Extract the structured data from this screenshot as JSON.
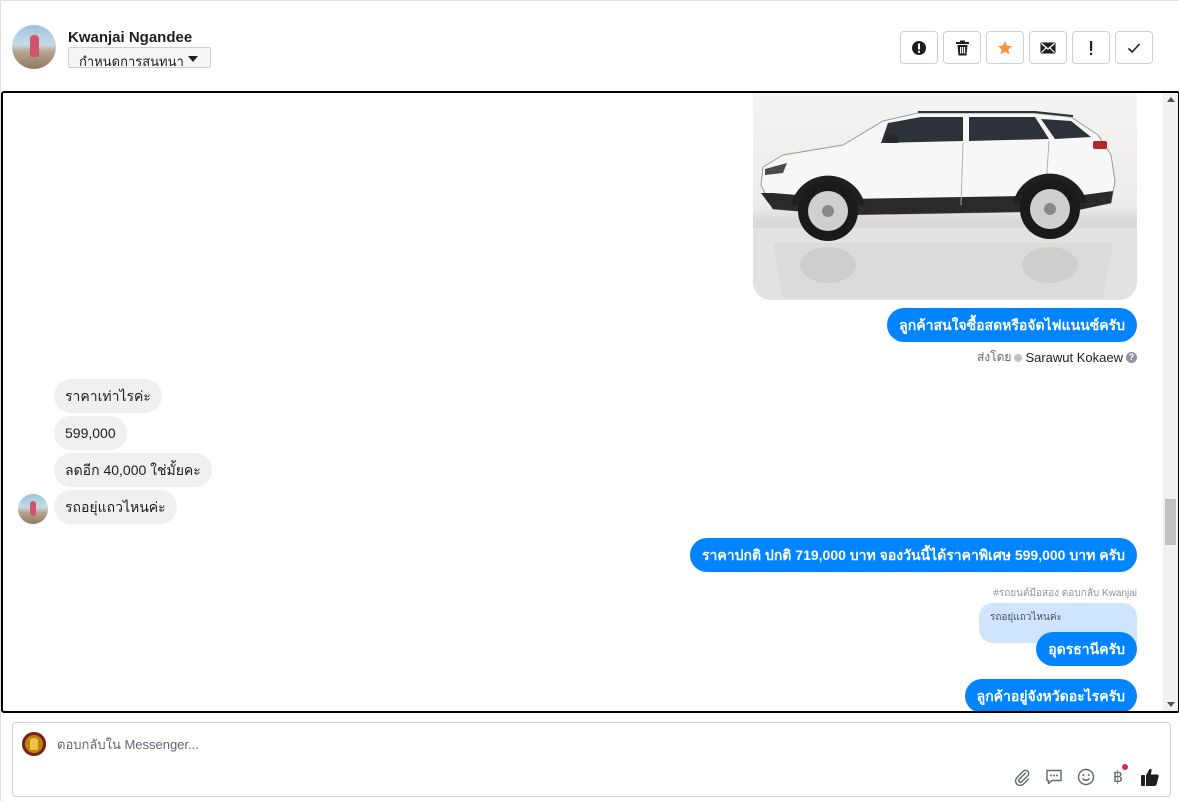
{
  "header": {
    "contact_name": "Kwanjai Ngandee",
    "assign_label": "กำหนดการสนทนา",
    "toolbar": [
      {
        "id": "spam",
        "icon": "alert-circle-icon"
      },
      {
        "id": "delete",
        "icon": "trash-icon"
      },
      {
        "id": "star",
        "icon": "star-icon",
        "color": "#f7923a"
      },
      {
        "id": "mark-unread",
        "icon": "envelope-icon"
      },
      {
        "id": "follow-up",
        "icon": "exclamation-icon"
      },
      {
        "id": "done",
        "icon": "check-icon"
      }
    ]
  },
  "conversation": {
    "attachment_icon": "car-photo",
    "messages": {
      "m1": "ลูกค้าสนใจซื้อสดหรือจัดไฟแนนซ์ครับ",
      "sent_by_prefix": "ส่งโดย",
      "sent_by_name": "Sarawut Kokaew",
      "m2": "ราคาเท่าไรค่ะ",
      "m3": "599,000",
      "m4": "ลดอีก 40,000 ใช่มั้ยคะ",
      "m5": "รถอยุ่แถวไหนค่ะ",
      "m6": "ราคาปกติ ปกติ 719,000 บาท จองวันนี้ได้ราคาพิเศษ 599,000 บาท ครับ",
      "reply_meta": "#รถยนต์มือสอง ตอบกลับ Kwanjai",
      "quoted": "รถอยุ่แถวไหนค่ะ",
      "m7": "อุดรธานีครับ",
      "m8": "ลูกค้าอยู่จังหวัดอะไรครับ"
    }
  },
  "composer": {
    "placeholder": "ตอบกลับใน Messenger...",
    "currency_symbol": "฿",
    "tools": [
      "paperclip-icon",
      "saved-replies-icon",
      "emoji-icon",
      "baht-icon",
      "thumbs-up-icon"
    ]
  },
  "colors": {
    "outgoing": "#0084ff",
    "incoming": "#f1f0f0",
    "quoted": "#cfe4ff",
    "star": "#f7923a"
  }
}
